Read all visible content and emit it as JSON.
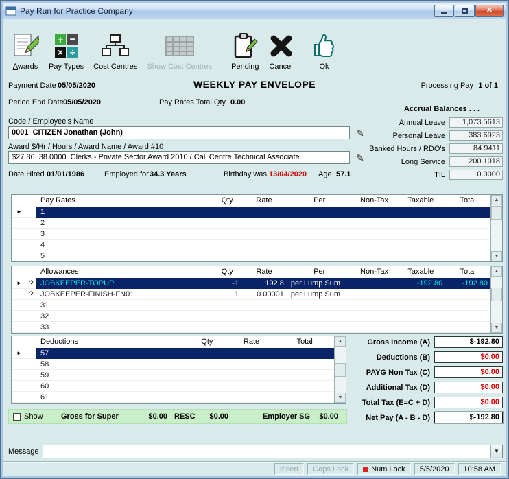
{
  "window": {
    "title": "Pay Run for Practice Company"
  },
  "icons": {
    "row_marker": "►",
    "question_flag": "?",
    "edit_pencil": "✎",
    "combo_arrow": "▼",
    "scroll_up": "▲",
    "scroll_down": "▼",
    "close": "✕"
  },
  "colors": {
    "selection": "#0a246a",
    "negative_red": "#e00000",
    "selected_name_cyan": "#00f0f0",
    "super_strip_green": "#c9efc9",
    "birthday_red": "#cf0000"
  },
  "toolbar": {
    "awards": "Awards",
    "pay_types": "Pay Types",
    "cost_centres": "Cost Centres",
    "show_cost_centres": "Show Cost Centres",
    "pending": "Pending",
    "cancel": "Cancel",
    "ok": "Ok"
  },
  "header": {
    "payment_date_label": "Payment Date",
    "payment_date": "05/05/2020",
    "envelope_title": "WEEKLY PAY ENVELOPE",
    "processing_label": "Processing Pay",
    "processing_value": "1 of 1",
    "period_end_label": "Period End Date",
    "period_end": "05/05/2020",
    "qty_label": "Pay Rates Total Qty",
    "qty_value": "0.00"
  },
  "accruals": {
    "heading": "Accrual Balances . . .",
    "rows": [
      {
        "label": "Annual Leave",
        "value": "1,073.5613"
      },
      {
        "label": "Personal Leave",
        "value": "383.6923"
      },
      {
        "label": "Banked Hours / RDO's",
        "value": "84.9411"
      },
      {
        "label": "Long Service",
        "value": "200.1018"
      },
      {
        "label": "TIL",
        "value": "0.0000"
      }
    ]
  },
  "employee": {
    "code_label": "Code / Employee's Name",
    "code_value": "0001  CITIZEN Jonathan (John)",
    "award_label": "Award $/Hr / Hours / Award Name / Award #10",
    "award_value": "$27.86  38.0000  Clerks - Private Sector Award 2010 / Call Centre Technical Associate",
    "hired_label": "Date Hired",
    "hired_value": "01/01/1986",
    "employed_label": "Employed for",
    "employed_value": "34.3 Years",
    "birthday_label": "Birthday was",
    "birthday_value": "13/04/2020",
    "age_label": "Age",
    "age_value": "57.1"
  },
  "pay_rates": {
    "col_name": "Pay Rates",
    "col_qty": "Qty",
    "col_rate": "Rate",
    "col_per": "Per",
    "col_nontax": "Non-Tax",
    "col_taxable": "Taxable",
    "col_total": "Total",
    "rows": [
      {
        "name": "1"
      },
      {
        "name": "2"
      },
      {
        "name": "3"
      },
      {
        "name": "4"
      },
      {
        "name": "5"
      }
    ]
  },
  "allowances": {
    "col_name": "Allowances",
    "col_qty": "Qty",
    "col_rate": "Rate",
    "col_per": "Per",
    "col_nontax": "Non-Tax",
    "col_taxable": "Taxable",
    "col_total": "Total",
    "rows": [
      {
        "flag": "?",
        "name": "JOBKEEPER-TOPUP",
        "qty": "-1",
        "rate": "192.8",
        "per": "per Lump Sum",
        "nontax": "",
        "taxable": "-192.80",
        "total": "-192.80"
      },
      {
        "flag": "?",
        "name": "JOBKEEPER-FINISH-FN01",
        "qty": "1",
        "rate": "0.00001",
        "per": "per Lump Sum",
        "nontax": "",
        "taxable": "",
        "total": ""
      },
      {
        "name": "31"
      },
      {
        "name": "32"
      },
      {
        "name": "33"
      }
    ]
  },
  "deductions": {
    "col_name": "Deductions",
    "col_qty": "Qty",
    "col_rate": "Rate",
    "col_total": "Total",
    "rows": [
      {
        "name": "57"
      },
      {
        "name": "58"
      },
      {
        "name": "59"
      },
      {
        "name": "60"
      },
      {
        "name": "61"
      }
    ]
  },
  "summary": {
    "gross_label": "Gross Income (A)",
    "gross_value": "$-192.80",
    "deductions_label": "Deductions (B)",
    "deductions_value": "$0.00",
    "payg_label": "PAYG Non Tax (C)",
    "payg_value": "$0.00",
    "additional_label": "Additional Tax (D)",
    "additional_value": "$0.00",
    "total_tax_label": "Total Tax (E=C + D)",
    "total_tax_value": "$0.00",
    "net_pay_label": "Net Pay  (A - B - D)",
    "net_pay_value": "$-192.80"
  },
  "super_strip": {
    "show_label": "Show",
    "gross_super_label": "Gross for Super",
    "gross_super_value": "$0.00",
    "resc_label": "RESC",
    "resc_value": "$0.00",
    "employer_sg_label": "Employer SG",
    "employer_sg_value": "$0.00"
  },
  "message": {
    "label": "Message",
    "value": ""
  },
  "statusbar": {
    "insert": "Insert",
    "caps_lock": "Caps Lock",
    "num_lock": "Num Lock",
    "date": "5/5/2020",
    "time": "10:58 AM"
  }
}
